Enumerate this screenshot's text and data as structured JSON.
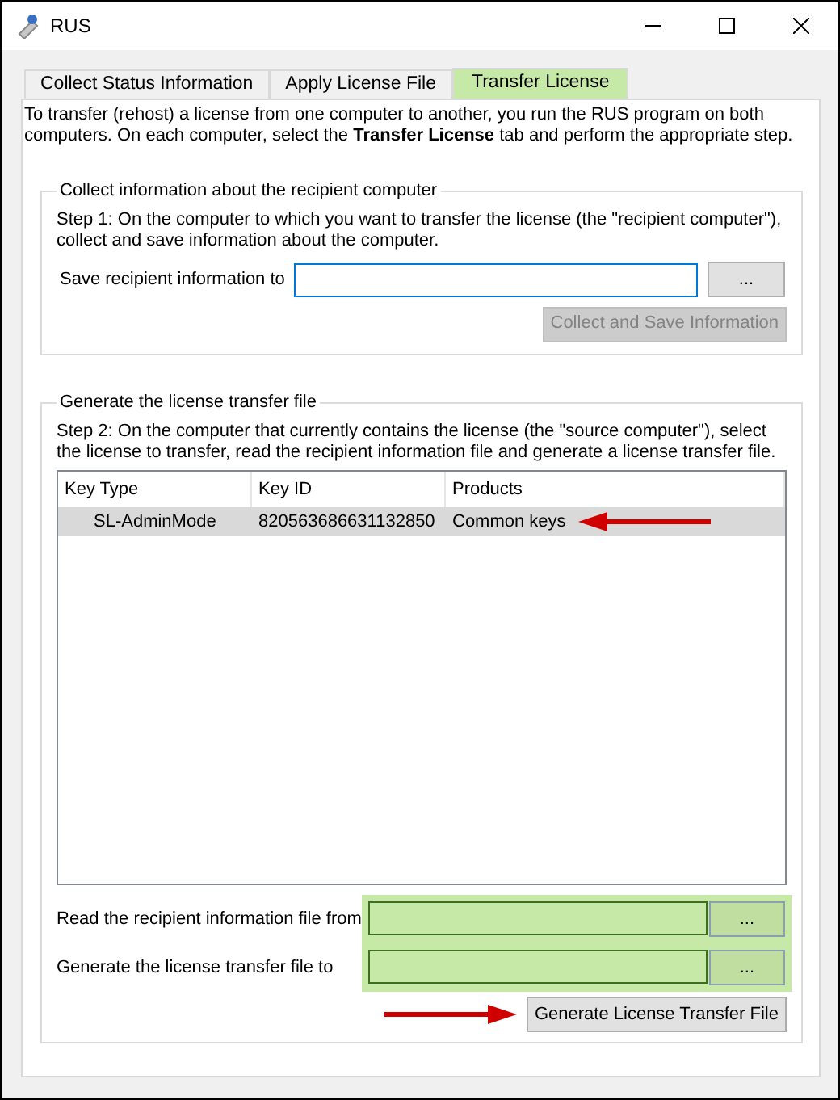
{
  "window": {
    "title": "RUS"
  },
  "tabs": [
    {
      "label": "Collect Status Information",
      "selected": false
    },
    {
      "label": "Apply License File",
      "selected": false
    },
    {
      "label": "Transfer License",
      "selected": true
    }
  ],
  "intro": "To transfer (rehost) a license from one computer to another, you run the RUS program on both computers. On each computer, select the **Transfer License** tab and perform the appropriate step.",
  "collect_group": {
    "title": "Collect information about the recipient computer",
    "step": "Step 1: On the computer to which you want to transfer the license (the \"recipient computer\"), collect and save information about the computer.",
    "field_label": "Save recipient information to",
    "browse": "...",
    "button": {
      "label": "Collect and Save Information",
      "disabled": true
    }
  },
  "generate_group": {
    "title": "Generate the license transfer file",
    "step": "Step 2: On the computer that currently contains the license (the \"source computer\"), select the license to transfer, read the recipient information file and generate a license transfer file.",
    "table": {
      "columns": [
        "Key Type",
        "Key ID",
        "Products"
      ],
      "rows": [
        {
          "cells": [
            "SL-AdminMode",
            "820563686631132850",
            "Common keys"
          ],
          "selected": true,
          "annotated": true
        }
      ]
    },
    "fields": [
      {
        "label": "Read the recipient information file from",
        "browse": "...",
        "highlighted": true
      },
      {
        "label": "Generate the license transfer file to",
        "browse": "...",
        "highlighted": true
      }
    ],
    "button": {
      "label": "Generate License Transfer File",
      "disabled": false,
      "annotated": true
    }
  }
}
